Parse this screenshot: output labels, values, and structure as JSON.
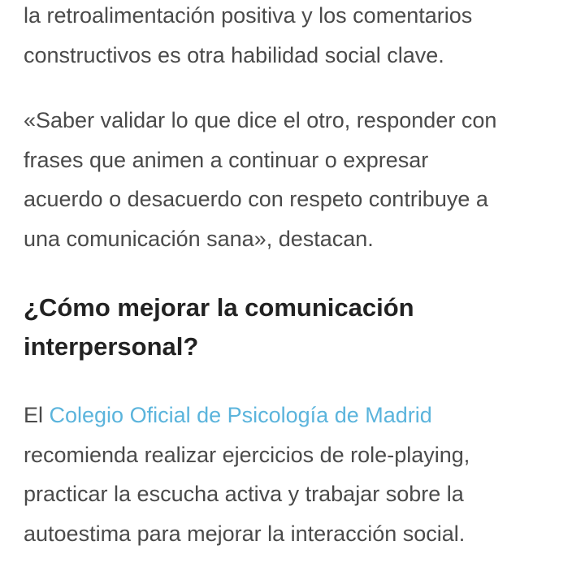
{
  "article": {
    "paragraph_1": {
      "lines": [
        "la retroalimentación positiva y los comentarios",
        "constructivos es otra habilidad social clave."
      ]
    },
    "paragraph_2": {
      "lines": [
        "«Saber validar lo que dice el otro, responder con",
        "frases que animen a continuar o expresar",
        "acuerdo o desacuerdo con respeto contribuye a",
        "una comunicación sana», destacan."
      ]
    },
    "heading": {
      "lines": [
        "¿Cómo mejorar la comunicación",
        "interpersonal?"
      ]
    },
    "paragraph_3": {
      "prefix": "El ",
      "link_text": "Colegio Oficial de Psicología de Madrid",
      "lines": [
        "recomienda realizar ejercicios de role-playing,",
        "practicar la escucha activa y trabajar sobre la",
        "autoestima para mejorar la interacción social."
      ]
    }
  },
  "colors": {
    "body_text": "#4a4a4a",
    "heading_text": "#222222",
    "link": "#5bb4dc",
    "background": "#ffffff"
  }
}
